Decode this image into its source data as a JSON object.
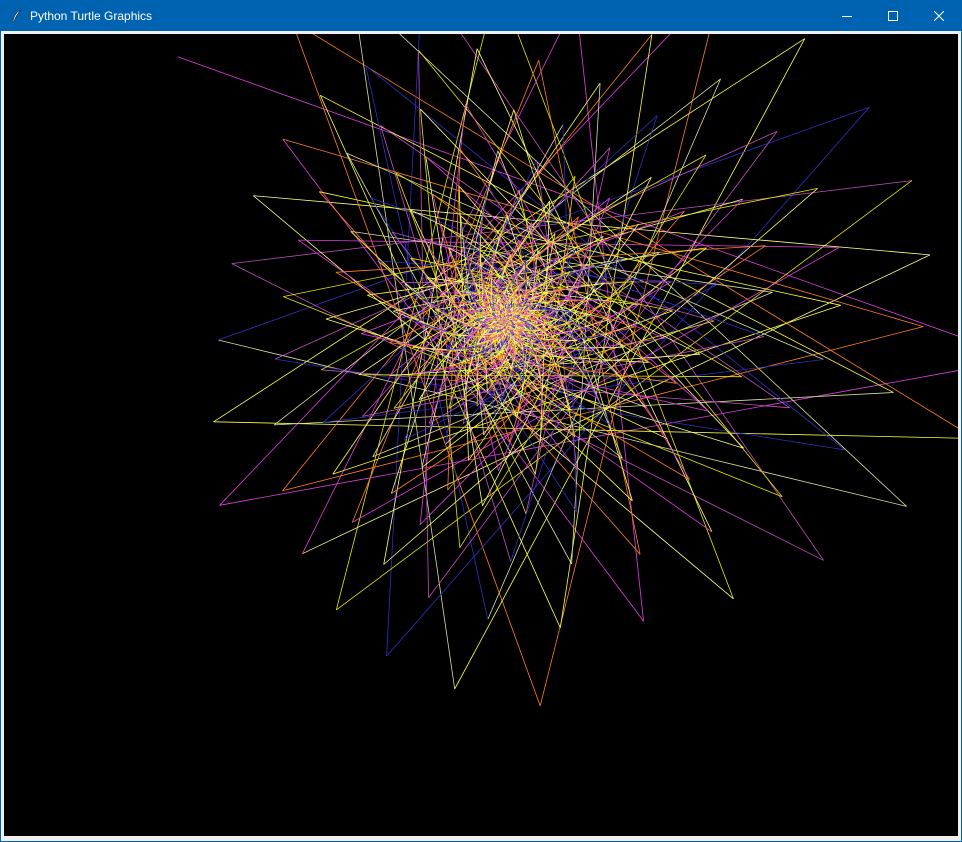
{
  "window": {
    "title": "Python Turtle Graphics",
    "icon": "feather-icon",
    "controls": [
      "minimize-icon",
      "maximize-icon",
      "close-icon"
    ]
  },
  "drawing": {
    "background": "#000000",
    "pen_colors": [
      "#e040e0",
      "#ff7f27",
      "#ffff40",
      "#d8e0a0",
      "#3030c0",
      "#c050c0",
      "#e6e600",
      "#ffff80"
    ]
  }
}
